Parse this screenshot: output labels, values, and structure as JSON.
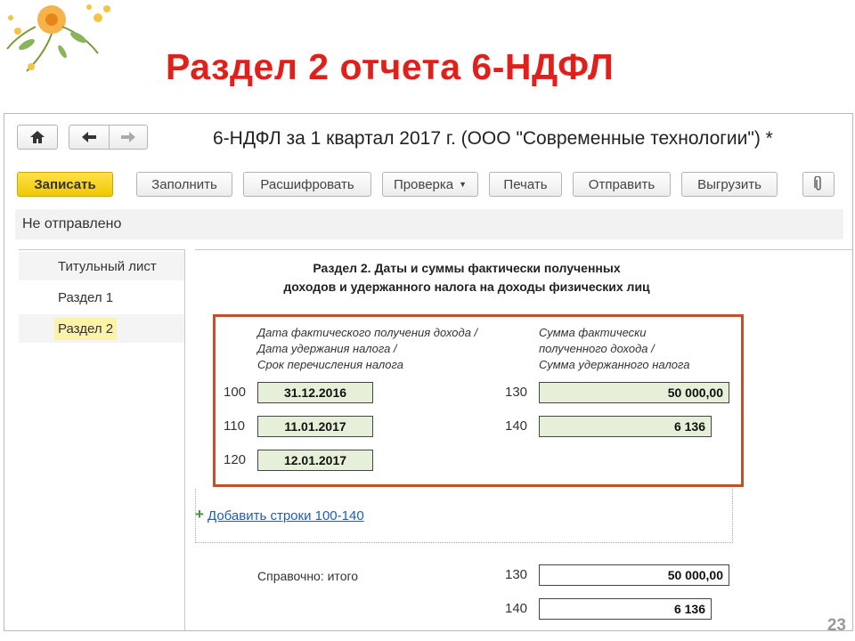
{
  "slide": {
    "title": "Раздел 2 отчета 6-НДФЛ",
    "page_number": "23"
  },
  "window": {
    "title": "6-НДФЛ за 1 квартал 2017 г. (ООО \"Современные технологии\") *",
    "status": "Не отправлено"
  },
  "toolbar": {
    "save": "Записать",
    "fill": "Заполнить",
    "decode": "Расшифровать",
    "check": "Проверка",
    "print": "Печать",
    "send": "Отправить",
    "export": "Выгрузить"
  },
  "sidebar": {
    "items": [
      {
        "label": "Титульный лист"
      },
      {
        "label": "Раздел 1"
      },
      {
        "label": "Раздел 2"
      }
    ]
  },
  "section": {
    "title_line1": "Раздел 2.  Даты и суммы фактически полученных",
    "title_line2": "доходов и удержанного налога на доходы физических лиц",
    "left_header": [
      "Дата фактического получения дохода /",
      "Дата удержания налога /",
      "Срок перечисления налога"
    ],
    "right_header": [
      "Сумма фактически",
      "полученного дохода /",
      "Сумма удержанного налога"
    ],
    "rows": {
      "code_100": "100",
      "value_100": "31.12.2016",
      "code_110": "110",
      "value_110": "11.01.2017",
      "code_120": "120",
      "value_120": "12.01.2017",
      "code_130": "130",
      "value_130": "50 000,00",
      "code_140": "140",
      "value_140": "6 136"
    },
    "add_rows": "Добавить строки 100-140",
    "totals": {
      "label": "Справочно: итого",
      "code_130": "130",
      "value_130": "50 000,00",
      "code_140": "140",
      "value_140": "6 136"
    }
  },
  "colors": {
    "title_red": "#e0201a",
    "frame_red": "#c0502a",
    "primary_yellow": "#f0c800",
    "field_green": "#e6f0d8",
    "link_blue": "#1f5fa8"
  }
}
